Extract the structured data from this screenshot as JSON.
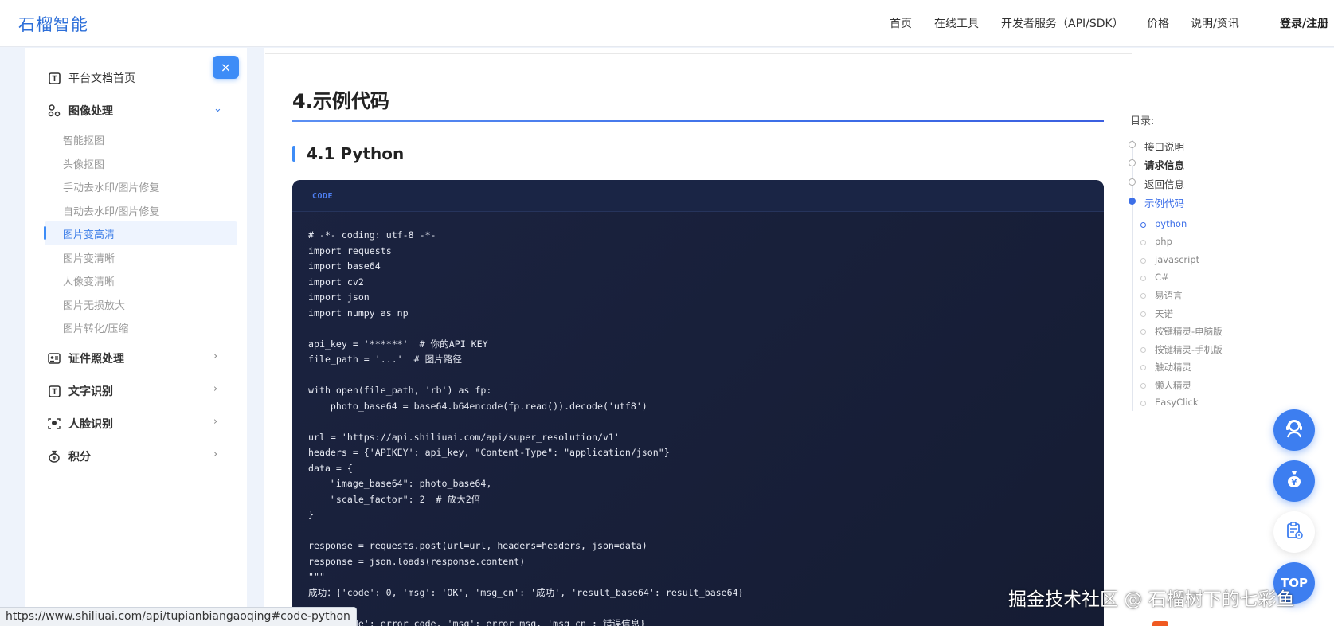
{
  "brand": "石榴智能",
  "nav": {
    "home": "首页",
    "tools": "在线工具",
    "dev": "开发者服务（API/SDK）",
    "price": "价格",
    "docs": "说明/资讯",
    "login": "登录/注册"
  },
  "sidebar": {
    "close": "×",
    "home": "平台文档首页",
    "image": "图像处理",
    "image_sub": [
      "智能抠图",
      "头像抠图",
      "手动去水印/图片修复",
      "自动去水印/图片修复",
      "图片变高清",
      "图片变清晰",
      "人像变清晰",
      "图片无损放大",
      "图片转化/压缩"
    ],
    "idphoto": "证件照处理",
    "ocr": "文字识别",
    "face": "人脸识别",
    "points": "积分"
  },
  "content": {
    "heading": "4.示例代码",
    "subheading": "4.1 Python",
    "code_label": "CODE",
    "code": "# -*- coding: utf-8 -*-\nimport requests\nimport base64\nimport cv2\nimport json\nimport numpy as np\n\napi_key = '******'  # 你的API KEY\nfile_path = '...'  # 图片路径\n\nwith open(file_path, 'rb') as fp:\n    photo_base64 = base64.b64encode(fp.read()).decode('utf8')\n\nurl = 'https://api.shiliuai.com/api/super_resolution/v1'\nheaders = {'APIKEY': api_key, \"Content-Type\": \"application/json\"}\ndata = {\n    \"image_base64\": photo_base64,\n    \"scale_factor\": 2  # 放大2倍\n}\n\nresponse = requests.post(url=url, headers=headers, json=data)\nresponse = json.loads(response.content)\n\"\"\"\n成功：{'code': 0, 'msg': 'OK', 'msg_cn': '成功', 'result_base64': result_base64}\n\n    {'code': error_code, 'msg': error_msg, 'msg_cn': 错误信息}"
  },
  "toc": {
    "title": "目录:",
    "items": [
      "接口说明",
      "请求信息",
      "返回信息",
      "示例代码"
    ],
    "subs": [
      "python",
      "php",
      "javascript",
      "C#",
      "易语言",
      "天诺",
      "按键精灵-电脑版",
      "按键精灵-手机版",
      "触动精灵",
      "懒人精灵",
      "EasyClick"
    ]
  },
  "fab": {
    "top": "TOP"
  },
  "watermark": "掘金技术社区 @ 石榴树下的七彩鱼",
  "status_url": "https://www.shiliuai.com/api/tupianbiangaoqing#code-python"
}
